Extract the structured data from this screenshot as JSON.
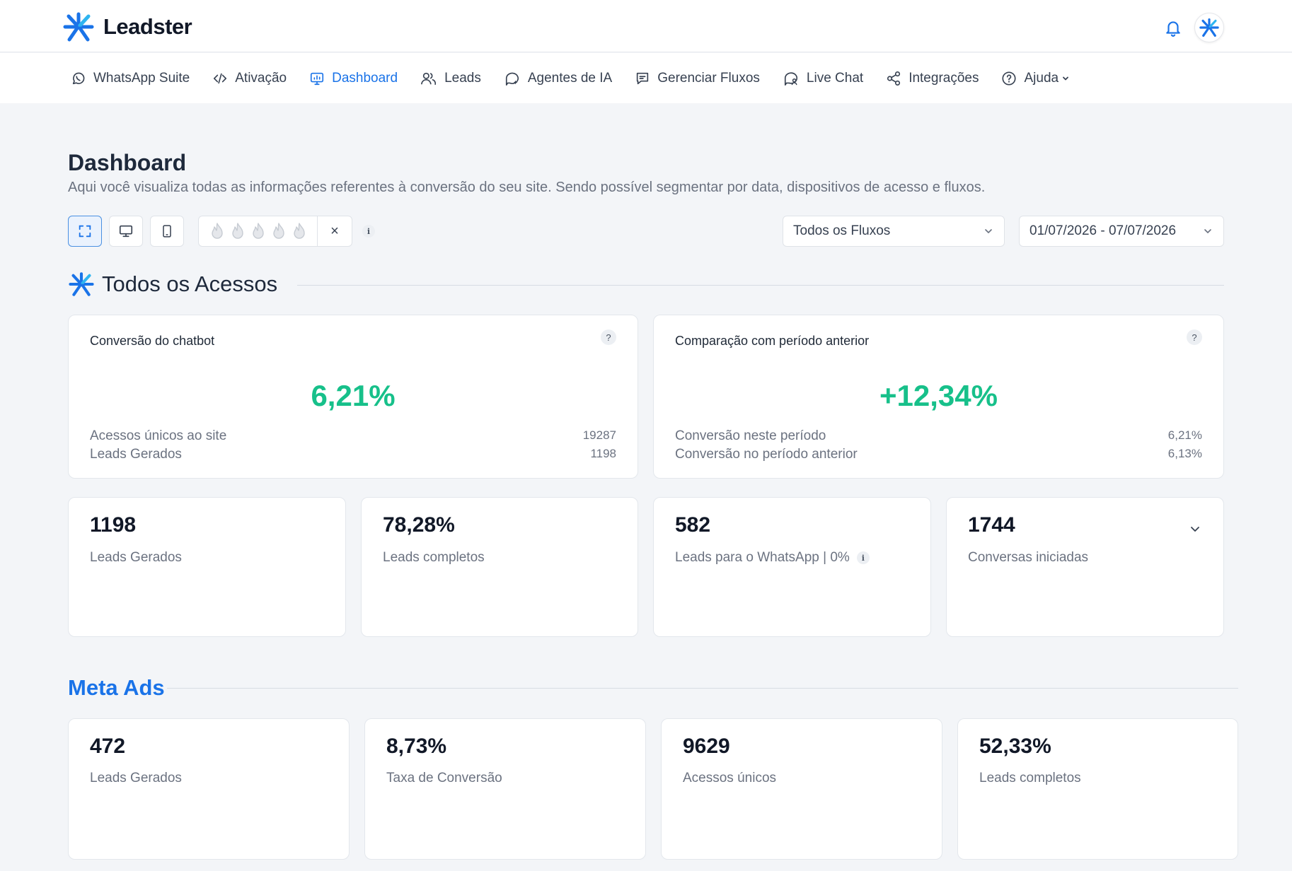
{
  "brand": {
    "name": "Leadster",
    "accent": "#1a73e8",
    "success": "#17c08a"
  },
  "nav": {
    "items": [
      {
        "label": "WhatsApp Suite",
        "icon": "whatsapp-icon"
      },
      {
        "label": "Ativação",
        "icon": "code-icon"
      },
      {
        "label": "Dashboard",
        "icon": "monitor-chart-icon",
        "active": true
      },
      {
        "label": "Leads",
        "icon": "users-icon"
      },
      {
        "label": "Agentes de IA",
        "icon": "chat-sparkle-icon"
      },
      {
        "label": "Gerenciar Fluxos",
        "icon": "message-square-icon"
      },
      {
        "label": "Live Chat",
        "icon": "chat-user-icon"
      },
      {
        "label": "Integrações",
        "icon": "share-nodes-icon"
      },
      {
        "label": "Ajuda",
        "icon": "help-circle-icon"
      }
    ]
  },
  "page": {
    "title": "Dashboard",
    "subtitle": "Aqui você visualiza todas as informações referentes à conversão do seu site. Sendo possível segmentar por data, dispositivos de acesso e fluxos."
  },
  "filters": {
    "devices": [
      "all-devices-icon",
      "desktop-icon",
      "mobile-icon"
    ],
    "selected_device": 0,
    "fire_rating_count": 5,
    "clear_symbol": "×",
    "info_symbol": "i",
    "flow_select": "Todos os Fluxos",
    "date_range": "01/07/2026 - 07/07/2026"
  },
  "section_all": {
    "title": "Todos os Acessos",
    "conversion_card": {
      "label": "Conversão do chatbot",
      "help": "?",
      "value": "6,21%",
      "rows": [
        {
          "label": "Acessos únicos ao site",
          "value": "19287"
        },
        {
          "label": "Leads Gerados",
          "value": "1198"
        }
      ]
    },
    "comparison_card": {
      "label": "Comparação com período anterior",
      "help": "?",
      "value": "+12,34%",
      "rows": [
        {
          "label": "Conversão neste período",
          "value": "6,21%"
        },
        {
          "label": "Conversão no período anterior",
          "value": "6,13%"
        }
      ]
    },
    "stats": [
      {
        "value": "1198",
        "label": "Leads Gerados"
      },
      {
        "value": "78,28%",
        "label": "Leads completos"
      },
      {
        "value": "582",
        "label": "Leads para o WhatsApp | 0%"
      },
      {
        "value": "1744",
        "label": "Conversas iniciadas"
      }
    ]
  },
  "section_meta": {
    "title": "Meta Ads",
    "stats": [
      {
        "value": "472",
        "label": "Leads Gerados"
      },
      {
        "value": "8,73%",
        "label": "Taxa de Conversão"
      },
      {
        "value": "9629",
        "label": "Acessos únicos"
      },
      {
        "value": "52,33%",
        "label": "Leads completos"
      }
    ]
  }
}
